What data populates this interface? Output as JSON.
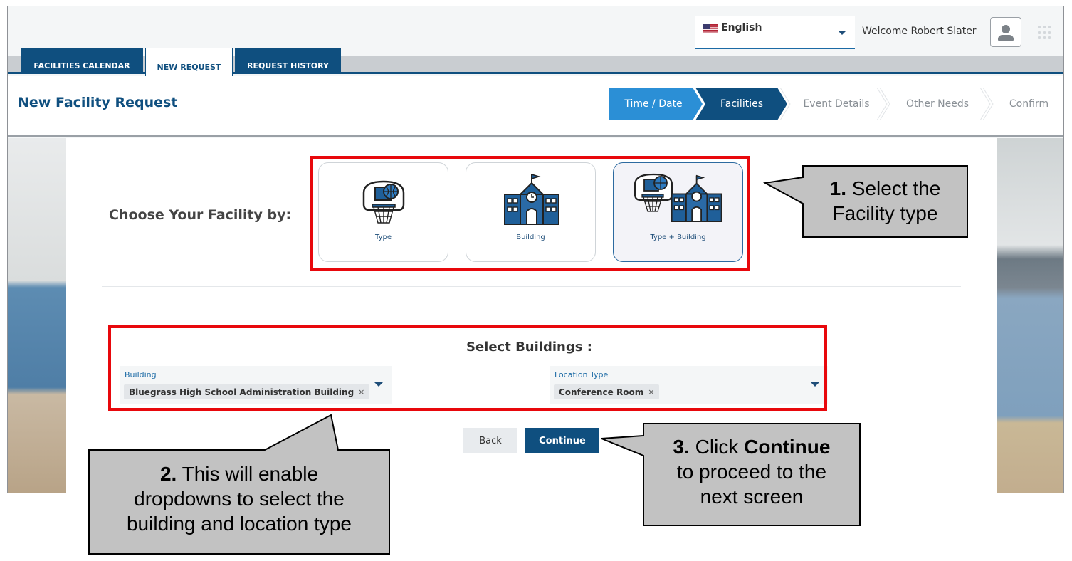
{
  "header": {
    "language": "English",
    "welcome": "Welcome Robert Slater"
  },
  "tabs": [
    {
      "label": "FACILITIES CALENDAR"
    },
    {
      "label": "NEW REQUEST"
    },
    {
      "label": "REQUEST HISTORY"
    }
  ],
  "page": {
    "title": "New Facility Request"
  },
  "steps": [
    {
      "label": "Time / Date",
      "state": "completed"
    },
    {
      "label": "Facilities",
      "state": "current"
    },
    {
      "label": "Event Details",
      "state": "upcoming"
    },
    {
      "label": "Other Needs",
      "state": "upcoming"
    },
    {
      "label": "Confirm",
      "state": "upcoming"
    }
  ],
  "colors": {
    "brand_dark": "#0f4f7f",
    "brand_light": "#2b8fd6",
    "annotation_red": "#e8080c",
    "callout_fill": "#c2c2c2"
  },
  "facility": {
    "choose_label": "Choose Your Facility by:",
    "options": [
      {
        "label": "Type",
        "icon": "basketball-hoop-icon",
        "selected": false
      },
      {
        "label": "Building",
        "icon": "school-building-icon",
        "selected": false
      },
      {
        "label": "Type + Building",
        "icon": "hoop-and-building-icon",
        "selected": true
      }
    ]
  },
  "buildings": {
    "title": "Select Buildings :",
    "building": {
      "label": "Building",
      "value": "Bluegrass High School Administration Building"
    },
    "location_type": {
      "label": "Location Type",
      "value": "Conference Room"
    },
    "chip_remove": "×"
  },
  "actions": {
    "back": "Back",
    "continue": "Continue"
  },
  "callouts": {
    "c1": {
      "num": "1.",
      "line1": " Select the",
      "line2": "Facility type"
    },
    "c2": {
      "num": "2.",
      "line1": " This will enable",
      "line2": "dropdowns to select the",
      "line3": "building and location type"
    },
    "c3": {
      "num": "3.",
      "line1_a": " Click ",
      "line1_b": "Continue",
      "line2": "to proceed to the",
      "line3": "next screen"
    }
  }
}
